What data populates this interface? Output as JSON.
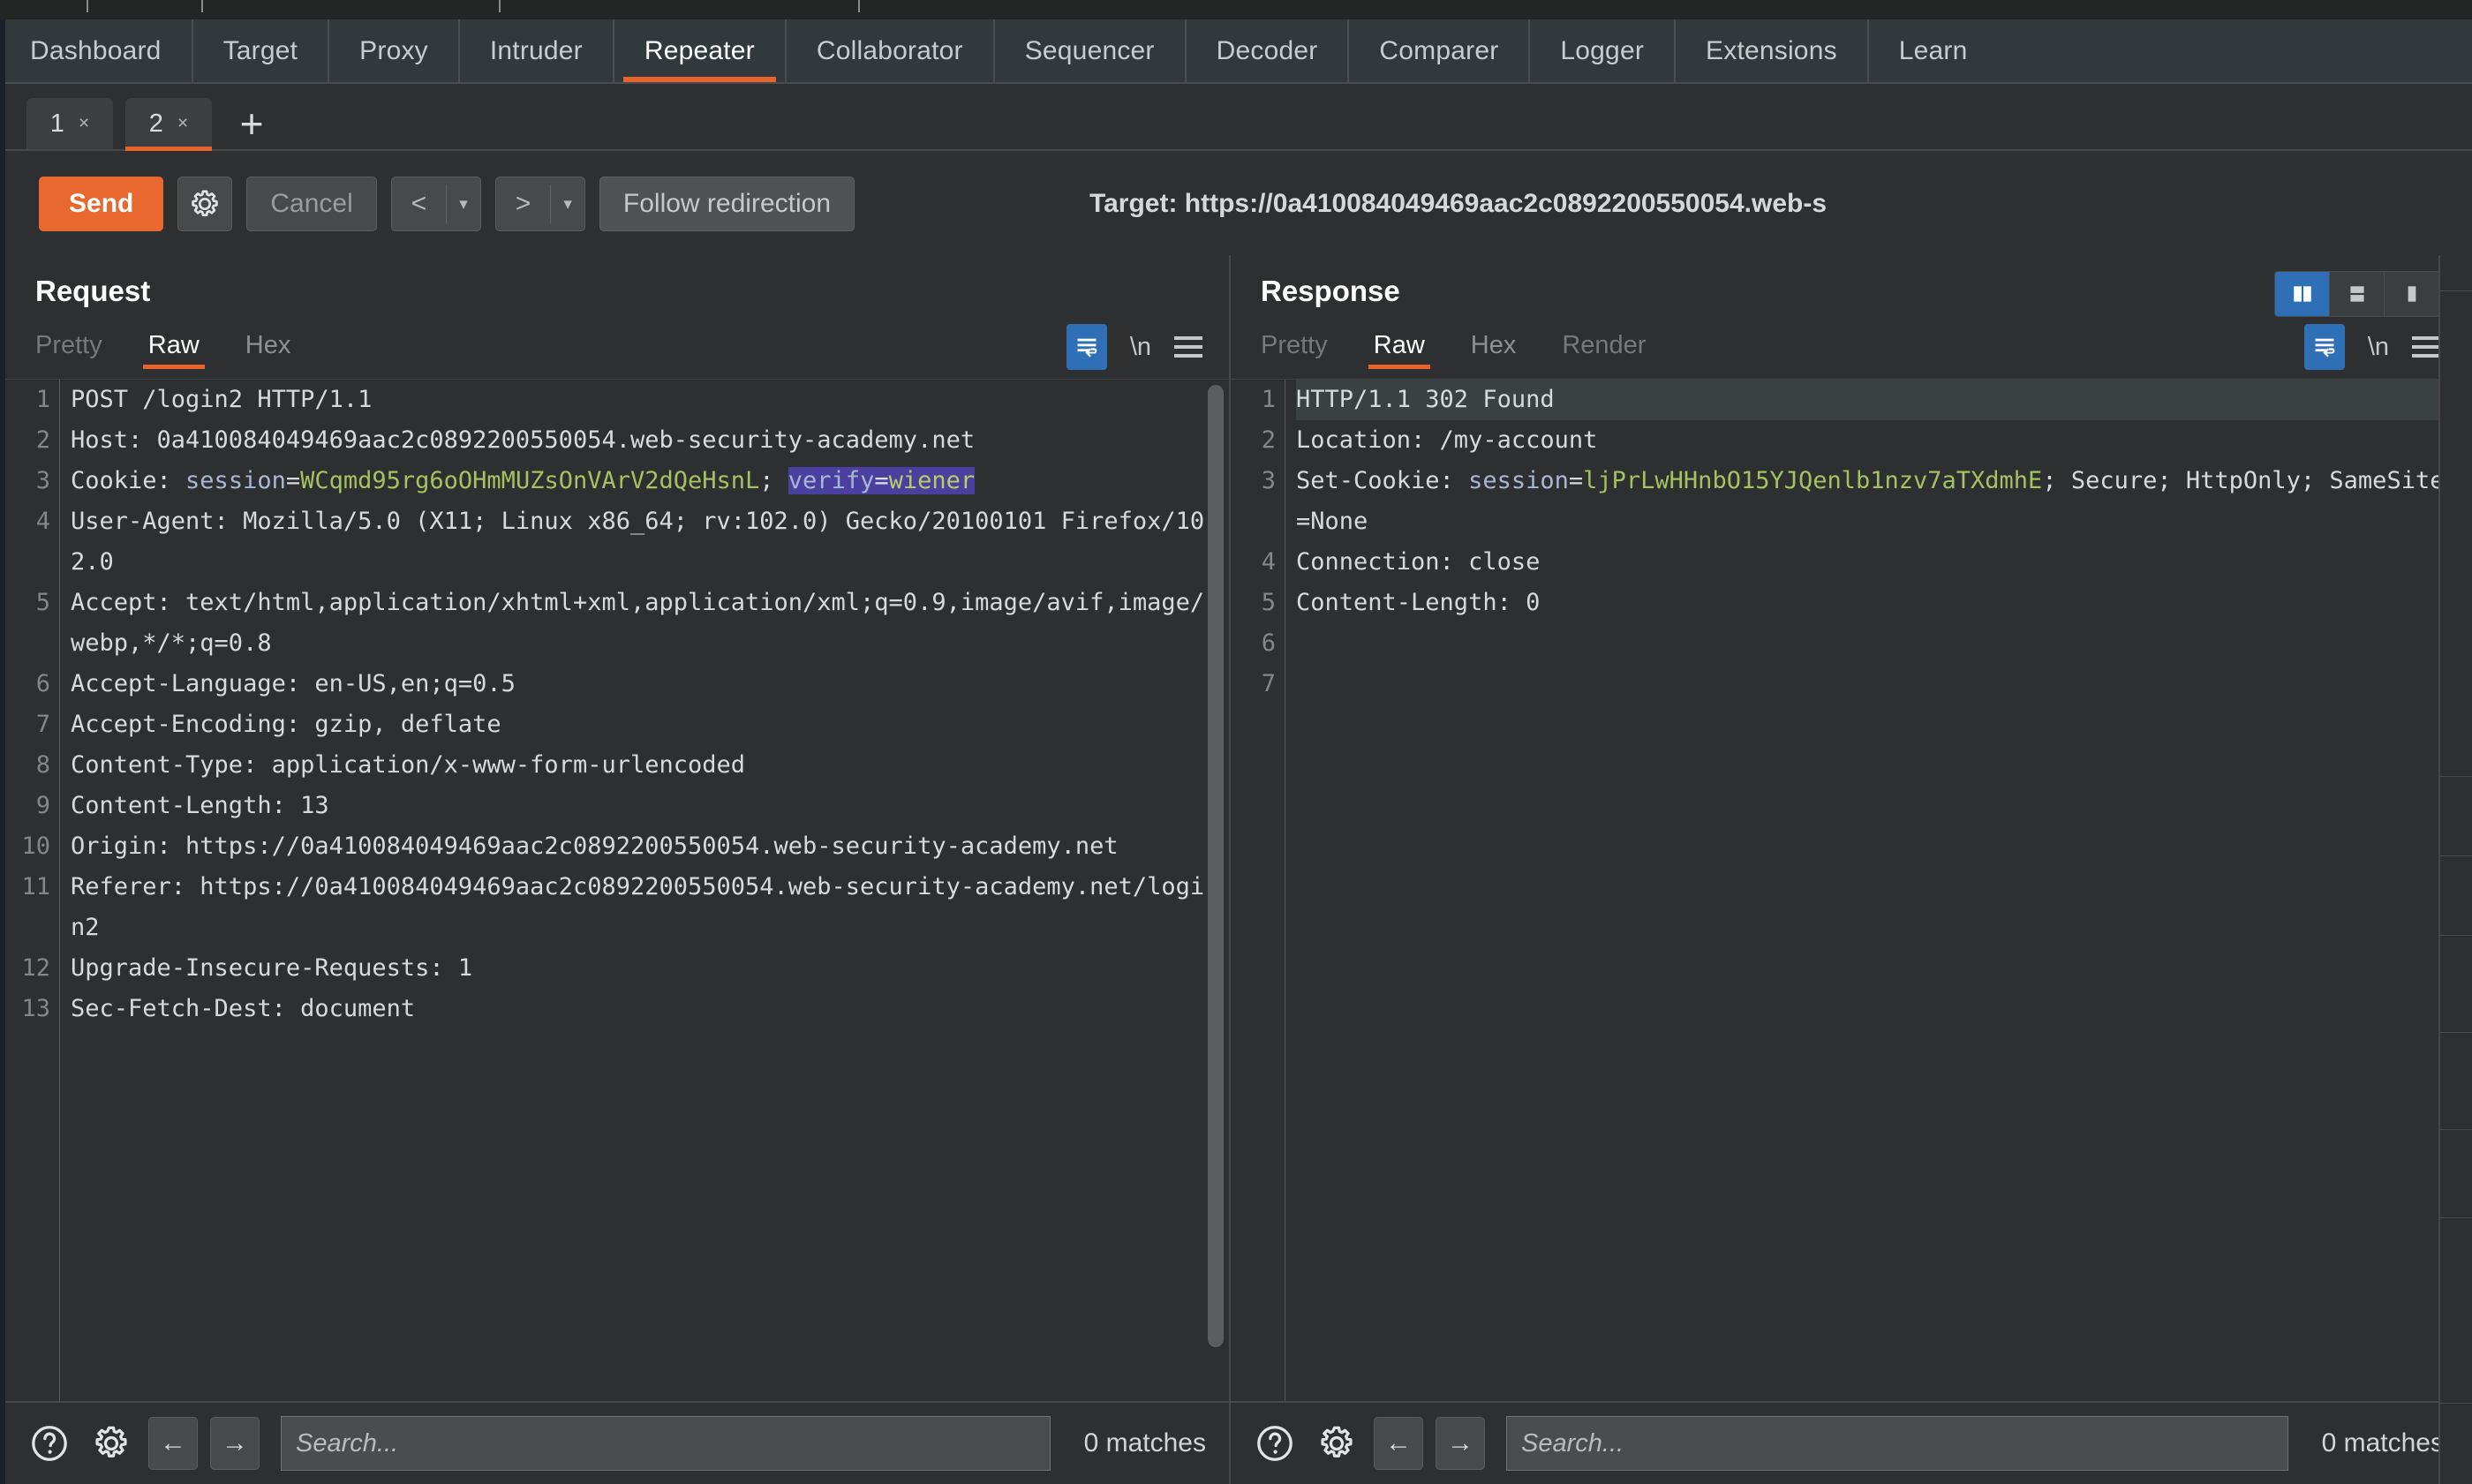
{
  "app": {
    "main_nav": [
      {
        "label": "Dashboard",
        "active": false
      },
      {
        "label": "Target",
        "active": false
      },
      {
        "label": "Proxy",
        "active": false
      },
      {
        "label": "Intruder",
        "active": false
      },
      {
        "label": "Repeater",
        "active": true
      },
      {
        "label": "Collaborator",
        "active": false
      },
      {
        "label": "Sequencer",
        "active": false
      },
      {
        "label": "Decoder",
        "active": false
      },
      {
        "label": "Comparer",
        "active": false
      },
      {
        "label": "Logger",
        "active": false
      },
      {
        "label": "Extensions",
        "active": false
      },
      {
        "label": "Learn",
        "active": false
      }
    ]
  },
  "repeater_tabs": {
    "tabs": [
      {
        "number": "1",
        "close": "×",
        "active": false
      },
      {
        "number": "2",
        "close": "×",
        "active": true
      }
    ],
    "add_label": "+"
  },
  "toolbar": {
    "send_label": "Send",
    "settings_icon": "gear-icon",
    "cancel_label": "Cancel",
    "back_label": "<",
    "back_arrow": "▾",
    "forward_label": ">",
    "forward_arrow": "▾",
    "follow_redirection_label": "Follow redirection",
    "target_label": "Target: https://0a410084049469aac2c0892200550054.web-s"
  },
  "request": {
    "title": "Request",
    "view_tabs": [
      {
        "label": "Pretty",
        "active": false,
        "dim": true
      },
      {
        "label": "Raw",
        "active": true,
        "dim": false
      },
      {
        "label": "Hex",
        "active": false,
        "dim": false
      }
    ],
    "wrap_icon": "word-wrap-icon",
    "newline_label": "\\n",
    "menu_icon": "hamburger-menu-icon",
    "lines": [
      {
        "n": "1",
        "text": "POST /login2 HTTP/1.1"
      },
      {
        "n": "2",
        "text": "Host: 0a410084049469aac2c0892200550054.web-security-academy.net"
      },
      {
        "n": "3",
        "text": "Cookie: session=WCqmd95rg6oOHmMUZsOnVArV2dQeHsnL; verify=wiener",
        "cookie": true,
        "prefix": "Cookie: ",
        "name1": "session",
        "val1": "WCqmd95rg6oOHmMUZsOnVArV2dQeHsnL",
        "sel_name": "verify",
        "sel_val": "wiener"
      },
      {
        "n": "4",
        "text": "User-Agent: Mozilla/5.0 (X11; Linux x86_64; rv:102.0) Gecko/20100101 Firefox/102.0"
      },
      {
        "n": "5",
        "text": "Accept: text/html,application/xhtml+xml,application/xml;q=0.9,image/avif,image/webp,*/*;q=0.8"
      },
      {
        "n": "6",
        "text": "Accept-Language: en-US,en;q=0.5"
      },
      {
        "n": "7",
        "text": "Accept-Encoding: gzip, deflate"
      },
      {
        "n": "8",
        "text": "Content-Type: application/x-www-form-urlencoded"
      },
      {
        "n": "9",
        "text": "Content-Length: 13"
      },
      {
        "n": "10",
        "text": "Origin: https://0a410084049469aac2c0892200550054.web-security-academy.net"
      },
      {
        "n": "11",
        "text": "Referer: https://0a410084049469aac2c0892200550054.web-security-academy.net/login2"
      },
      {
        "n": "12",
        "text": "Upgrade-Insecure-Requests: 1"
      },
      {
        "n": "13",
        "text": "Sec-Fetch-Dest: document"
      }
    ],
    "search": {
      "help_icon": "help-icon",
      "settings_icon": "gear-icon",
      "prev_icon": "←",
      "next_icon": "→",
      "placeholder": "Search...",
      "value": "",
      "matches": "0 matches"
    }
  },
  "response": {
    "title": "Response",
    "layout_toggle": [
      {
        "name": "side-by-side-layout",
        "active": true
      },
      {
        "name": "stacked-layout",
        "active": false
      },
      {
        "name": "single-pane-layout",
        "active": false
      }
    ],
    "view_tabs": [
      {
        "label": "Pretty",
        "active": false,
        "dim": true
      },
      {
        "label": "Raw",
        "active": true,
        "dim": false
      },
      {
        "label": "Hex",
        "active": false,
        "dim": false
      },
      {
        "label": "Render",
        "active": false,
        "dim": true
      }
    ],
    "wrap_icon": "word-wrap-icon",
    "newline_label": "\\n",
    "menu_icon": "hamburger-menu-icon",
    "lines": [
      {
        "n": "1",
        "text": "HTTP/1.1 302 Found",
        "highlight": true
      },
      {
        "n": "2",
        "text": "Location: /my-account"
      },
      {
        "n": "3",
        "text": "Set-Cookie: session=ljPrLwHHnbO15YJQenlb1nzv7aTXdmhE; Secure; HttpOnly; SameSite=None",
        "setcookie": true,
        "prefix": "Set-Cookie: ",
        "name1": "session",
        "val1": "ljPrLwHHnbO15YJQenlb1nzv7aTXdmhE",
        "suffix": "; Secure; HttpOnly; SameSite=None"
      },
      {
        "n": "4",
        "text": "Connection: close"
      },
      {
        "n": "5",
        "text": "Content-Length: 0"
      },
      {
        "n": "6",
        "text": ""
      },
      {
        "n": "7",
        "text": ""
      }
    ],
    "search": {
      "help_icon": "help-icon",
      "settings_icon": "gear-icon",
      "prev_icon": "←",
      "next_icon": "→",
      "placeholder": "Search...",
      "value": "",
      "matches": "0 matches"
    }
  },
  "colors": {
    "accent": "#e8622c",
    "send_button": "#e8682f",
    "active_toggle": "#2f6fb5",
    "selection": "#4b3fa0",
    "cookie_value": "#a5c261",
    "header_name": "#a9b7d6",
    "panel_bg": "#2d2f30"
  }
}
